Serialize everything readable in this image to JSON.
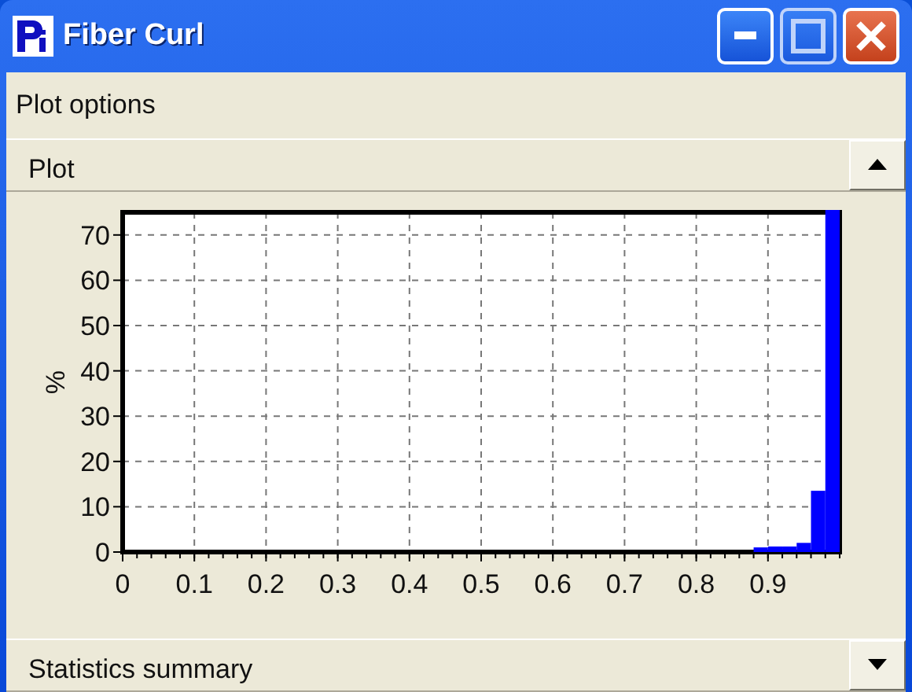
{
  "window": {
    "title": "Fiber Curl"
  },
  "menu": {
    "label": "Plot options"
  },
  "sections": [
    {
      "title": "Plot",
      "expanded": true
    },
    {
      "title": "Statistics summary",
      "expanded": false
    }
  ],
  "chart_data": {
    "type": "bar",
    "ylabel": "%",
    "x": [
      0.89,
      0.91,
      0.93,
      0.95,
      0.97,
      0.99
    ],
    "series": [
      {
        "color": "#0000ff",
        "values": [
          0.5,
          0.7,
          0.7,
          1.5,
          13,
          75
        ]
      }
    ],
    "grid": true,
    "xlim": [
      0,
      1
    ],
    "ylim": [
      0,
      75
    ],
    "xticks": [
      0,
      0.1,
      0.2,
      0.3,
      0.4,
      0.5,
      0.6,
      0.7,
      0.8,
      0.9
    ],
    "yticks": [
      0,
      10,
      20,
      30,
      40,
      50,
      60,
      70
    ]
  }
}
